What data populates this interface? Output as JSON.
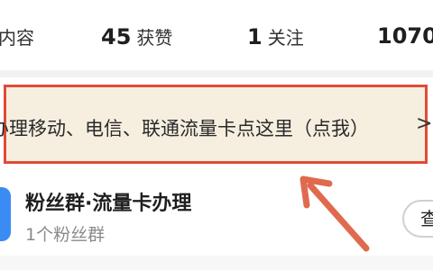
{
  "stats": [
    {
      "num": "",
      "label": "内容"
    },
    {
      "num": "45",
      "label": "获赞"
    },
    {
      "num": "1",
      "label": "关注"
    },
    {
      "num": "1070",
      "label": ""
    }
  ],
  "banner": {
    "text": "办理移动、电信、联通流量卡点这里（点我）",
    "chevron": ">"
  },
  "group": {
    "title": "粉丝群·流量卡办理",
    "subtitle": "1个粉丝群",
    "button_label": "查看"
  },
  "colors": {
    "highlight_border": "#e24a38",
    "banner_bg": "#f6efe0",
    "arrow": "#e06a4e",
    "group_icon": "#3a8bf4"
  }
}
